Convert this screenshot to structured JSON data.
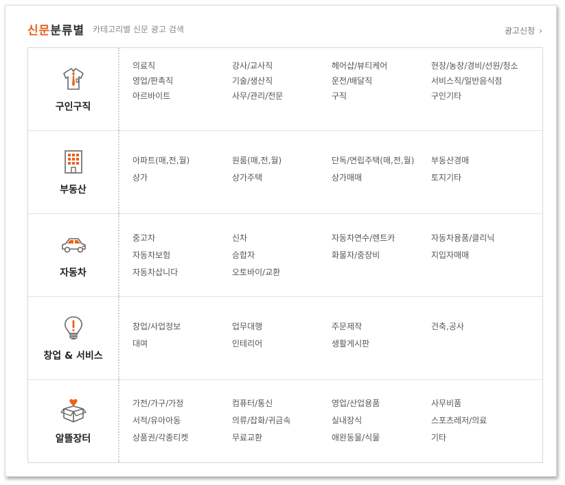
{
  "header": {
    "title_accent": "신문",
    "title_rest": "분류별",
    "subtitle": "카테고리별 신문 광고 검색",
    "ad_link": "광고신청",
    "ad_chevron": "›"
  },
  "colors": {
    "accent": "#e8621a",
    "icon_gray": "#666666"
  },
  "categories": [
    {
      "label": "구인구직",
      "icon": "shirt-tie-icon",
      "items": [
        "의료직",
        "강사/교사직",
        "헤어샵/뷰티케어",
        "현장/농장/경비/선원/청소",
        "영업/판촉직",
        "기술/생산직",
        "운전/배달직",
        "서비스직/일반음식점",
        "아르바이트",
        "사무/관리/전문",
        "구직",
        "구인기타"
      ]
    },
    {
      "label": "부동산",
      "icon": "building-icon",
      "items": [
        "아파트(매,전,월)",
        "원룸(매,전,월)",
        "단독/연립주택(매,전,월)",
        "부동산경매",
        "상가",
        "상가주택",
        "상가매매",
        "토지기타"
      ]
    },
    {
      "label": "자동차",
      "icon": "car-icon",
      "items": [
        "중고차",
        "신차",
        "자동차연수/렌트카",
        "자동차용품/클리닉",
        "자동차보험",
        "승합자",
        "화물자/중장비",
        "지입자매매",
        "자동차삽니다",
        "오토바이/교환"
      ]
    },
    {
      "label": "창업 & 서비스",
      "icon": "lightbulb-icon",
      "items": [
        "창업/사업정보",
        "업무대행",
        "주문제작",
        "건축,공사",
        "대여",
        "인테리어",
        "생활게시판"
      ]
    },
    {
      "label": "알뜰장터",
      "icon": "gift-box-heart-icon",
      "items": [
        "가전/가구/가정",
        "컴퓨터/통신",
        "영업/산업용품",
        "사무비품",
        "서적/유아아동",
        "의류/잡화/귀금속",
        "실내장식",
        "스포츠레저/의료",
        "상품권/각종티켓",
        "무료교환",
        "애완동물/식물",
        "기타"
      ]
    }
  ]
}
